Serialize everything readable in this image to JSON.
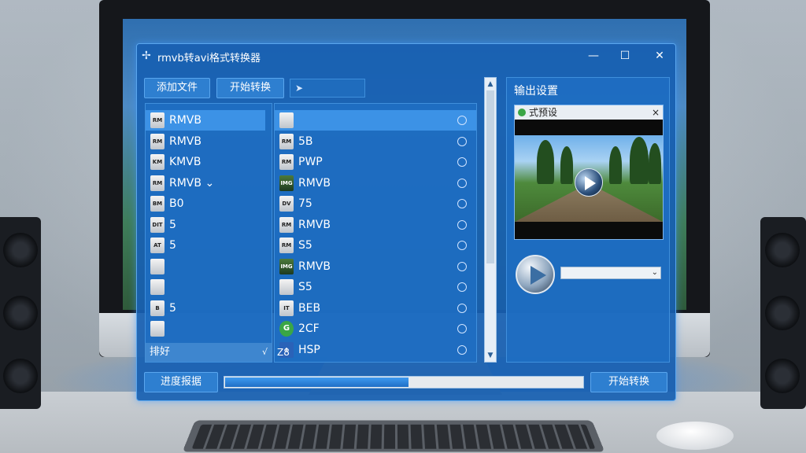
{
  "window": {
    "title": "rmvb转avi格式转换器"
  },
  "toolbar": {
    "add_label": "添加文件",
    "start_label": "开始转换",
    "field_text": "➤"
  },
  "left_list": [
    {
      "label": "RMVB",
      "selected": true,
      "icon": "RM"
    },
    {
      "label": "RMVB",
      "icon": "RM"
    },
    {
      "label": "KMVB",
      "icon": "KM"
    },
    {
      "label": "RMVB ⌄",
      "icon": "RM"
    },
    {
      "label": "B0",
      "icon": "BM"
    },
    {
      "label": "5",
      "icon": "DIT"
    },
    {
      "label": "5",
      "icon": "AT"
    },
    {
      "label": "",
      "icon": ""
    },
    {
      "label": "",
      "icon": ""
    },
    {
      "label": "5",
      "icon": "B"
    },
    {
      "label": "",
      "icon": ""
    }
  ],
  "left_footer": {
    "label": "排好",
    "check": "√"
  },
  "mid_list": [
    {
      "label": "",
      "selected": true,
      "icon": ""
    },
    {
      "label": "5B",
      "icon": "RM"
    },
    {
      "label": "PWP",
      "icon": "RM"
    },
    {
      "label": "RMVB",
      "icon": "IMG"
    },
    {
      "label": "75",
      "icon": "DV"
    },
    {
      "label": "RMVB",
      "icon": "RM"
    },
    {
      "label": "S5",
      "icon": "RM"
    },
    {
      "label": "RMVB",
      "icon": "IMG"
    },
    {
      "label": "S5",
      "icon": ""
    },
    {
      "label": "BEB",
      "icon": "IT"
    },
    {
      "label": "2CF",
      "icon": "G"
    },
    {
      "label": "HSP",
      "icon": "I"
    }
  ],
  "mid_footer": {
    "label": "Z8"
  },
  "settings": {
    "title": "输出设置",
    "preview_title": "式预设",
    "preview_close": "×",
    "format_value": ""
  },
  "bottom": {
    "progress_label": "进度报据",
    "progress": 0.51,
    "start_label": "开始转换"
  }
}
